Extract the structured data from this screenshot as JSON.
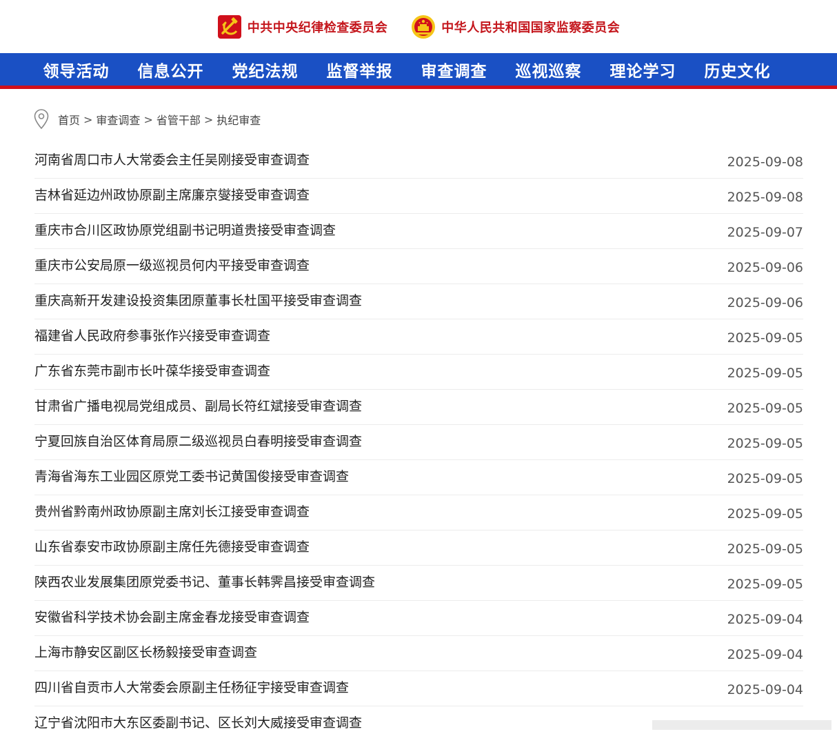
{
  "header": {
    "left_brand": "中共中央纪律检查委员会",
    "right_brand": "中华人民共和国国家监察委员会",
    "left_emblem_icon": "party-emblem-icon",
    "right_emblem_icon": "national-emblem-icon"
  },
  "nav": {
    "items": [
      "领导活动",
      "信息公开",
      "党纪法规",
      "监督举报",
      "审查调查",
      "巡视巡察",
      "理论学习",
      "历史文化"
    ]
  },
  "breadcrumb": {
    "icon": "location-pin-icon",
    "items": [
      "首页",
      "审查调查",
      "省管干部",
      "执纪审查"
    ],
    "separator": ">"
  },
  "articles": [
    {
      "title": "河南省周口市人大常委会主任吴刚接受审查调查",
      "date": "2025-09-08"
    },
    {
      "title": "吉林省延边州政协原副主席廉京燮接受审查调查",
      "date": "2025-09-08"
    },
    {
      "title": "重庆市合川区政协原党组副书记明道贵接受审查调查",
      "date": "2025-09-07"
    },
    {
      "title": "重庆市公安局原一级巡视员何内平接受审查调查",
      "date": "2025-09-06"
    },
    {
      "title": "重庆高新开发建设投资集团原董事长杜国平接受审查调查",
      "date": "2025-09-06"
    },
    {
      "title": "福建省人民政府参事张作兴接受审查调查",
      "date": "2025-09-05"
    },
    {
      "title": "广东省东莞市副市长叶葆华接受审查调查",
      "date": "2025-09-05"
    },
    {
      "title": "甘肃省广播电视局党组成员、副局长符红斌接受审查调查",
      "date": "2025-09-05"
    },
    {
      "title": "宁夏回族自治区体育局原二级巡视员白春明接受审查调查",
      "date": "2025-09-05"
    },
    {
      "title": "青海省海东工业园区原党工委书记黄国俊接受审查调查",
      "date": "2025-09-05"
    },
    {
      "title": "贵州省黔南州政协原副主席刘长江接受审查调查",
      "date": "2025-09-05"
    },
    {
      "title": "山东省泰安市政协原副主席任先德接受审查调查",
      "date": "2025-09-05"
    },
    {
      "title": "陕西农业发展集团原党委书记、董事长韩霁昌接受审查调查",
      "date": "2025-09-05"
    },
    {
      "title": "安徽省科学技术协会副主席金春龙接受审查调查",
      "date": "2025-09-04"
    },
    {
      "title": "上海市静安区副区长杨毅接受审查调查",
      "date": "2025-09-04"
    },
    {
      "title": "四川省自贡市人大常委会原副主任杨征宇接受审查调查",
      "date": "2025-09-04"
    },
    {
      "title": "辽宁省沈阳市大东区委副书记、区长刘大威接受审查调查",
      "date": ""
    }
  ],
  "colors": {
    "nav_background": "#1a50c4",
    "nav_bottom_stripe": "#d0101b",
    "brand_red": "#c4161c",
    "emblem_gold": "#f5c518"
  }
}
